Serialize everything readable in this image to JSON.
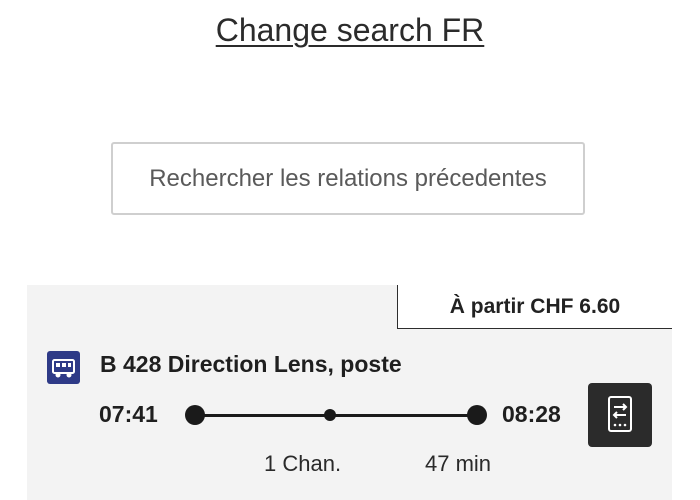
{
  "header": {
    "change_search_label": "Change search FR"
  },
  "actions": {
    "previous_connections_label": "Rechercher les relations précedentes"
  },
  "connection": {
    "price_label": "À partir CHF 6.60",
    "line_label": "B 428 Direction Lens, poste",
    "departure_time": "07:41",
    "arrival_time": "08:28",
    "changes_label": "1 Chan.",
    "duration_label": "47 min",
    "transport_icon": "bus-icon",
    "ticket_icon": "ticket-icon",
    "colors": {
      "bus_icon_bg": "#2e3a87",
      "ticket_button_bg": "#2b2b2b",
      "card_bg": "#f3f3f3"
    }
  }
}
